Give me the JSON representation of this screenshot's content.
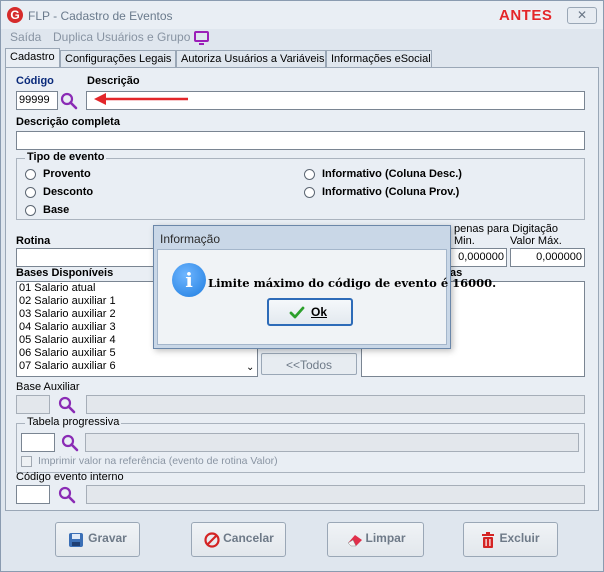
{
  "window": {
    "title": "FLP - Cadastro de Eventos",
    "tag": "ANTES",
    "close_symbol": "✕"
  },
  "menu": {
    "items": [
      "Saída",
      "Duplica Usuários e Grupo"
    ]
  },
  "tabs": [
    "Cadastro",
    "Configurações Legais",
    "Autoriza Usuários a Variáveis",
    "Informações eSocial"
  ],
  "form": {
    "codigo_label": "Código",
    "codigo_value": "99999",
    "descricao_label": "Descrição",
    "descricao_value": "",
    "descricao_completa_label": "Descrição completa",
    "tipo_evento_label": "Tipo de evento",
    "tipo_options": [
      "Provento",
      "Desconto",
      "Base",
      "Informativo (Coluna Desc.)",
      "Informativo (Coluna Prov.)"
    ],
    "rotina_label": "Rotina",
    "apenas_digitacao_label": "penas para Digitação",
    "min_label": "Min.",
    "max_label": "Valor Máx.",
    "min_value": "0,000000",
    "max_value": "0,000000",
    "bases_disponiveis_label": "Bases Disponíveis",
    "bases_selecionadas_label": "as",
    "bases": [
      "01 Salario atual",
      "02 Salario auxiliar 1",
      "03 Salario auxiliar 2",
      "04 Salario auxiliar 3",
      "05 Salario auxiliar 4",
      "06 Salario auxiliar 5",
      "07 Salario auxiliar 6"
    ],
    "todos_button": "<<Todos",
    "base_auxiliar_label": "Base Auxiliar",
    "tabela_progressiva_label": "Tabela progressiva",
    "imprimir_label": "Imprimir valor na referência (evento de rotina Valor)",
    "codigo_interno_label": "Código evento interno"
  },
  "footer": {
    "gravar": "Gravar",
    "cancelar": "Cancelar",
    "limpar": "Limpar",
    "excluir": "Excluir"
  },
  "dialog": {
    "title": "Informação",
    "message": "Limite máximo do código de evento é 16000.",
    "ok": "Ok"
  },
  "colors": {
    "accent_red": "#e3262a",
    "icon_purple": "#9b1fb8",
    "info_blue": "#1f7de0",
    "ok_green": "#2ca02c"
  }
}
